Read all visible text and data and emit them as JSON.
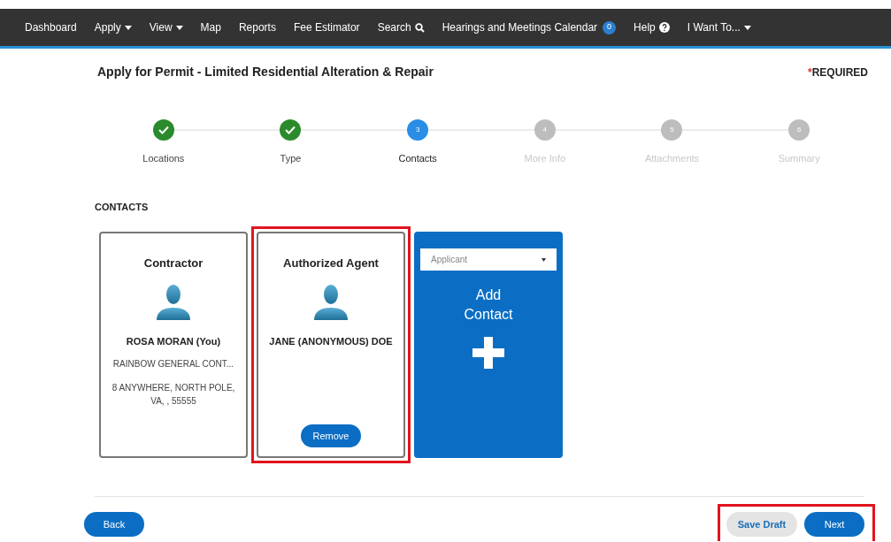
{
  "nav": [
    {
      "label": "Dashboard",
      "kind": "plain"
    },
    {
      "label": "Apply",
      "kind": "dropdown"
    },
    {
      "label": "View",
      "kind": "dropdown"
    },
    {
      "label": "Map",
      "kind": "plain"
    },
    {
      "label": "Reports",
      "kind": "plain"
    },
    {
      "label": "Fee Estimator",
      "kind": "plain"
    },
    {
      "label": "Search",
      "kind": "search"
    },
    {
      "label": "Hearings and Meetings Calendar",
      "kind": "badge",
      "badge": "0"
    },
    {
      "label": "Help",
      "kind": "help"
    },
    {
      "label": "I Want To...",
      "kind": "dropdown"
    }
  ],
  "page_title": "Apply for Permit - Limited Residential Alteration & Repair",
  "required": {
    "mark": "*",
    "label": "REQUIRED"
  },
  "steps": [
    {
      "label": "Locations",
      "done": true,
      "selected": false
    },
    {
      "label": "Type",
      "done": true,
      "selected": false
    },
    {
      "label": "Contacts",
      "number": "3",
      "done": false,
      "selected": true
    },
    {
      "label": "More Info",
      "number": "4",
      "done": false,
      "selected": false
    },
    {
      "label": "Attachments",
      "number": "5",
      "done": false,
      "selected": false
    },
    {
      "label": "Summary",
      "number": "6",
      "done": false,
      "selected": false
    }
  ],
  "section_title": "CONTACTS",
  "cards": [
    {
      "kind": "contact",
      "title": "Contractor",
      "name": "ROSA MORAN (You)",
      "company": "RAINBOW GENERAL CONT...",
      "address": "8 ANYWHERE, NORTH POLE, VA, , 55555",
      "highlighted": false
    },
    {
      "kind": "contact",
      "title": "Authorized Agent",
      "name": "JANE (ANONYMOUS) DOE",
      "button": "Remove",
      "highlighted": true
    },
    {
      "kind": "add",
      "select": "Applicant",
      "label": "Add Contact",
      "highlighted": false
    }
  ],
  "footer": {
    "back": "Back",
    "save_draft": "Save Draft",
    "next": "Next",
    "actions_highlighted": true
  }
}
